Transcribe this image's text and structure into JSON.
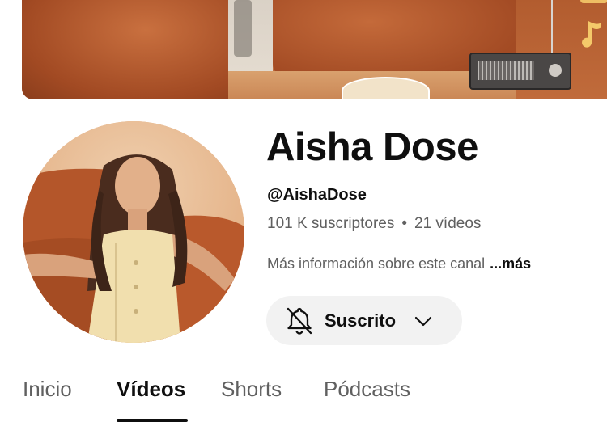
{
  "channel": {
    "name": "Aisha Dose",
    "handle": "@AishaDose",
    "subscribers": "101 K suscriptores",
    "separator": "•",
    "videos": "21 vídeos",
    "about": "Más información sobre este canal",
    "more": "...más"
  },
  "subscribe_button": {
    "label": "Suscrito",
    "bell_icon": "bell-off-icon",
    "chevron_icon": "chevron-down-icon"
  },
  "tabs": [
    {
      "label": "Inicio",
      "active": false
    },
    {
      "label": "Vídeos",
      "active": true
    },
    {
      "label": "Shorts",
      "active": false
    },
    {
      "label": "Pódcasts",
      "active": false
    }
  ],
  "colors": {
    "primary_text": "#0f0f0f",
    "secondary_text": "#606060",
    "button_bg": "#f2f2f2",
    "banner_accent": "#a9532b"
  }
}
